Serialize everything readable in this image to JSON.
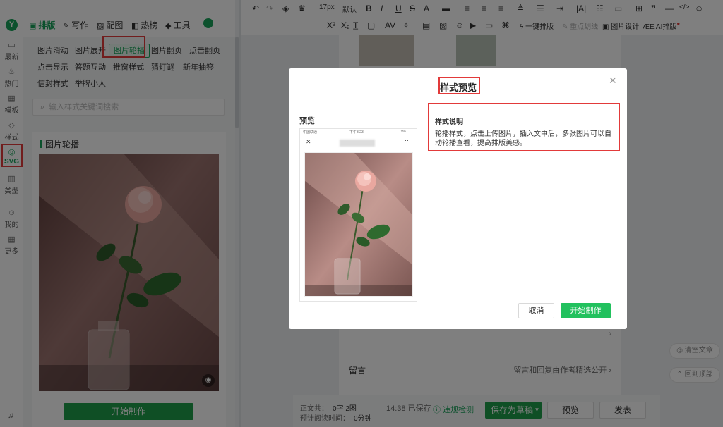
{
  "rail": {
    "logo": "Y",
    "items": [
      {
        "label": "最新",
        "icon": "chat-icon"
      },
      {
        "label": "热门",
        "icon": "fire-icon"
      },
      {
        "label": "模板",
        "icon": "grid-icon"
      },
      {
        "label": "样式",
        "icon": "drop-icon"
      },
      {
        "label": "SVG",
        "icon": "svg-icon"
      },
      {
        "label": "类型",
        "icon": "columns-icon"
      },
      {
        "label": "我的",
        "icon": "user-icon"
      },
      {
        "label": "更多",
        "icon": "more-grid-icon"
      }
    ]
  },
  "topmenu": {
    "items": [
      "排版",
      "写作",
      "配图",
      "热榜",
      "工具"
    ]
  },
  "toolbar": {
    "font_size": "17px",
    "font_default": "默认",
    "bold": "B",
    "italic": "I",
    "underline": "U",
    "strike": "S",
    "color": "A",
    "sup": "X²",
    "sub": "X₂",
    "one_click": "一键排版",
    "key_divider": "重点划线",
    "img_design": "图片设计",
    "ai_layout": "AI排版"
  },
  "left": {
    "tags": [
      "图片滑动",
      "图片展开",
      "图片轮播",
      "图片翻页",
      "点击翻页",
      "点击显示",
      "答题互动",
      "推窗样式",
      "猜灯谜",
      "新年抽签",
      "信封样式",
      "举牌小人"
    ],
    "active_tag": "图片轮播",
    "search_placeholder": "输入样式关键词搜索",
    "card_title": "图片轮播",
    "card_button": "开始制作"
  },
  "article": {
    "comment_label": "留言",
    "comment_value": "留言和回复由作者精选公开 ›"
  },
  "status": {
    "text_label": "正文共：",
    "text_value": "0字 2图",
    "read_label": "预计阅读时间：",
    "read_value": "0分钟",
    "saved": "14:38 已保存",
    "check": "违规检测",
    "save_draft": "保存为草稿",
    "preview": "预览",
    "publish": "发表"
  },
  "floats": {
    "clear": "清空文章",
    "back_top": "回到顶部"
  },
  "modal": {
    "title": "样式预览",
    "preview_label": "预览",
    "desc_title": "样式说明",
    "desc_text": "轮播样式，点击上传图片，插入文中后，多张图片可以自动轮播查看，提高排版美感。",
    "cancel": "取消",
    "start": "开始制作",
    "phone_carrier": "中国联通",
    "phone_time": "下午3:23",
    "phone_battery": "79%"
  },
  "colors": {
    "brand_green": "#19a35a",
    "highlight_red": "#e23a3a"
  }
}
